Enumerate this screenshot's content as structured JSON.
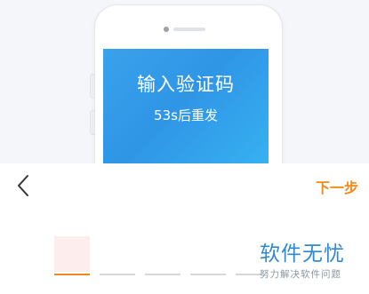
{
  "screen": {
    "title": "输入验证码",
    "countdown": "53s后重发"
  },
  "nav": {
    "back_icon": "chevron-left-icon",
    "next_label": "下一步"
  },
  "progress": {
    "steps_total": 5,
    "active_step": 1
  },
  "watermark": {
    "title": "软件无忧",
    "subtitle": "努力解决软件问题"
  },
  "colors": {
    "accent_orange": "#f08a1c",
    "screen_blue": "#3aa2ec",
    "brand_blue": "#2f88d3"
  }
}
